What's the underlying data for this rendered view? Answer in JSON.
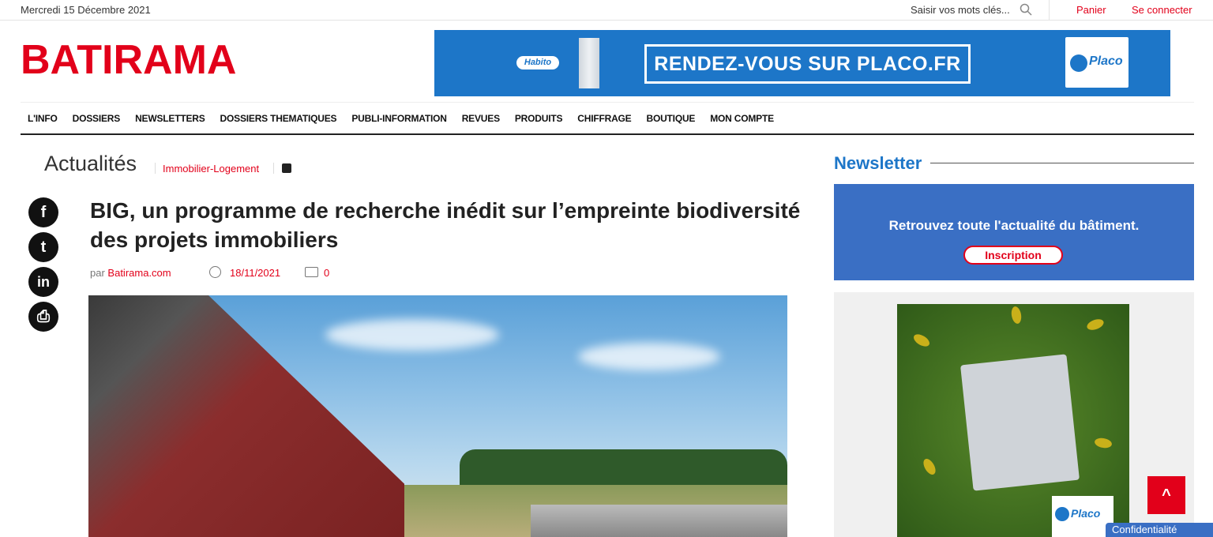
{
  "topbar": {
    "date": "Mercredi 15 Décembre 2021",
    "search_placeholder": "Saisir vos mots clés...",
    "cart": "Panier",
    "login": "Se connecter"
  },
  "logo": "BATIRAMA",
  "banner": {
    "habito": "Habito",
    "cta": "RENDEZ-VOUS SUR PLACO.FR",
    "brand": "Placo"
  },
  "nav": {
    "items": [
      "L'INFO",
      "DOSSIERS",
      "NEWSLETTERS",
      "DOSSIERS THEMATIQUES",
      "PUBLI-INFORMATION",
      "REVUES",
      "PRODUITS",
      "CHIFFRAGE",
      "BOUTIQUE",
      "MON COMPTE"
    ]
  },
  "section": {
    "title": "Actualités",
    "tag": "Immobilier-Logement"
  },
  "share": {
    "facebook": "f",
    "twitter": "t",
    "linkedin": "in",
    "print": "⎙"
  },
  "article": {
    "headline": "BIG, un programme de recherche inédit sur l’empreinte biodiversité des projets immobiliers",
    "by_prefix": "par",
    "author": "Batirama.com",
    "date": "18/11/2021",
    "comments": "0"
  },
  "newsletter": {
    "heading": "Newsletter",
    "text": "Retrouvez toute l'actualité du bâtiment.",
    "button": "Inscription"
  },
  "sidebar_ad": {
    "brand": "Placo"
  },
  "back_to_top": "^",
  "privacy": "Confidentialité"
}
